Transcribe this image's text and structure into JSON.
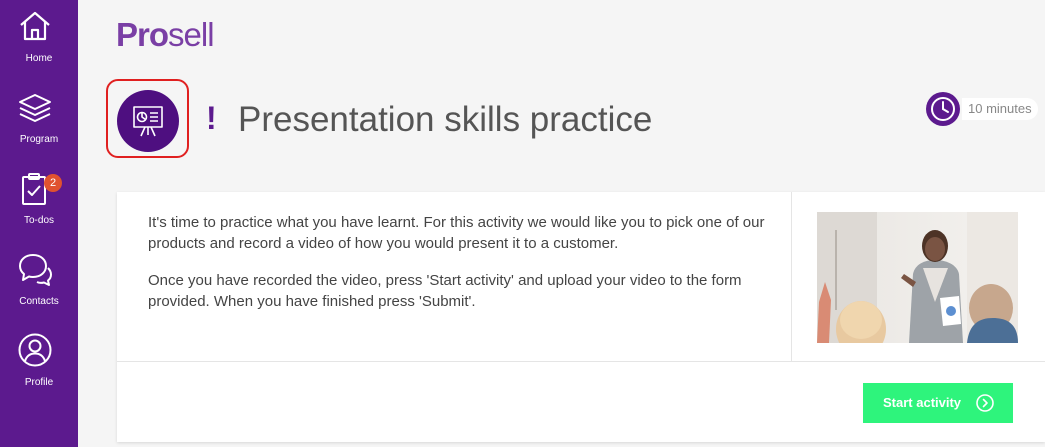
{
  "sidebar": {
    "items": [
      {
        "label": "Home",
        "icon": "home-icon"
      },
      {
        "label": "Program",
        "icon": "layers-icon"
      },
      {
        "label": "To-dos",
        "icon": "clipboard-check-icon",
        "badge": "2"
      },
      {
        "label": "Contacts",
        "icon": "chat-bubbles-icon"
      },
      {
        "label": "Profile",
        "icon": "user-circle-icon"
      }
    ]
  },
  "logo": {
    "pro": "Pro",
    "sell": "sell"
  },
  "activity": {
    "icon": "presentation-board-icon",
    "marker": "!",
    "title": "Presentation skills practice",
    "duration": "10 minutes",
    "paragraph1": "It's time to practice what you have learnt. For this activity we would like you to pick one of our products and record a video of how you would present it to a customer.",
    "paragraph2": "Once you have recorded the video, press 'Start activity' and upload your video to the form provided. When you have finished press 'Submit'.",
    "start_label": "Start activity"
  },
  "colors": {
    "sidebar": "#5c1a8e",
    "accent": "#4e0f80",
    "badge": "#e0522f",
    "start_button": "#2ef47c"
  }
}
